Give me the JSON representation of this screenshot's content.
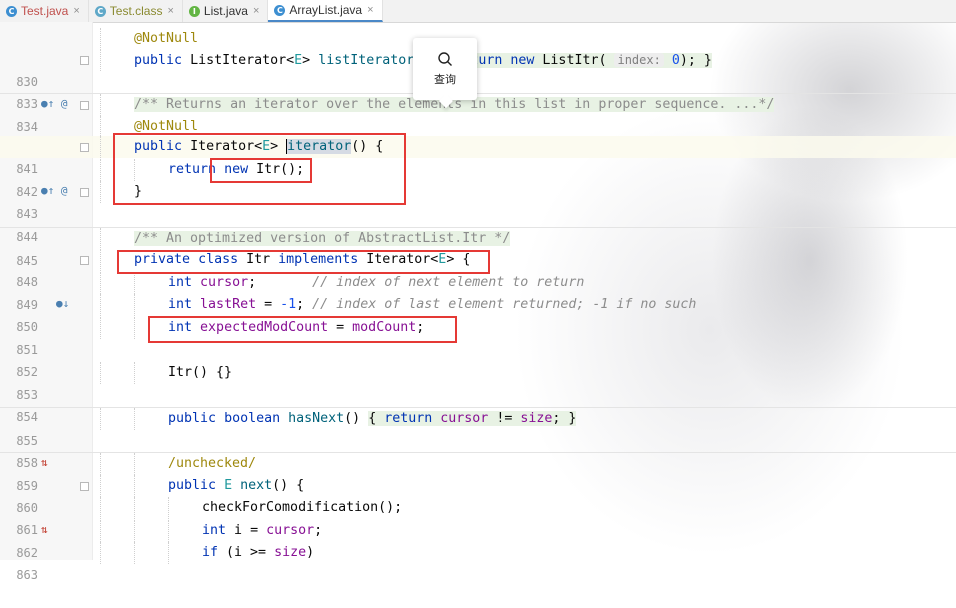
{
  "tabs": [
    {
      "name": "Test.java",
      "icon": "class-icon",
      "style": "red"
    },
    {
      "name": "Test.class",
      "icon": "class-file-icon",
      "style": "olive"
    },
    {
      "name": "List.java",
      "icon": "interface-icon",
      "style": "plain"
    },
    {
      "name": "ArrayList.java",
      "icon": "class-icon",
      "style": "active"
    }
  ],
  "tab_close": "×",
  "popup": {
    "label": "查询",
    "icon": "search-icon"
  },
  "lines": {
    "l0": {
      "num": "",
      "text": "@NotNull"
    },
    "l830": {
      "num": "830",
      "mark": "●↑ @"
    },
    "l833": {
      "num": "833"
    },
    "l834": {
      "num": "834",
      "text": "/** Returns an iterator over the elements in this list in proper sequence. ...*/"
    },
    "l834b": {
      "text": "@NotNull"
    },
    "l841": {
      "num": "841",
      "mark": "●↑ @"
    },
    "l842": {
      "num": "842"
    },
    "l843": {
      "num": "843"
    },
    "l844": {
      "num": "844"
    },
    "l845": {
      "num": "845",
      "text": "/** An optimized version of AbstractList.Itr */"
    },
    "l848": {
      "num": "848",
      "mark": "●↓"
    },
    "l849": {
      "num": "849",
      "comment": "// index of next element to return"
    },
    "l850": {
      "num": "850",
      "comment": "// index of last element returned; -1 if no such"
    },
    "l851": {
      "num": "851"
    },
    "l852": {
      "num": "852"
    },
    "l853": {
      "num": "853"
    },
    "l854": {
      "num": "854"
    },
    "l855": {
      "num": "855",
      "mark": "⇅"
    },
    "l858": {
      "num": "858"
    },
    "l859": {
      "num": "859",
      "text": "/unchecked/"
    },
    "l860": {
      "num": "860",
      "mark": "⇅"
    },
    "l861": {
      "num": "861"
    },
    "l862": {
      "num": "862"
    },
    "l863": {
      "num": "863"
    }
  },
  "tokens": {
    "public": "public",
    "private": "private",
    "class": "class",
    "implements": "implements",
    "return": "return",
    "new": "new",
    "int": "int",
    "boolean": "boolean",
    "if": "if",
    "ListIterator": "ListIterator",
    "E": "E",
    "listIterator": "listIterator",
    "ListItr": "ListItr",
    "index_hint": "index:",
    "zero": "0",
    "Iterator": "Iterator",
    "iterator": "iterator",
    "Itr": "Itr",
    "cursor": "cursor",
    "lastRet": "lastRet",
    "neg1": "-1",
    "expectedModCount": "expectedModCount",
    "modCount": "modCount",
    "hasNext": "hasNext",
    "size": "size",
    "next": "next",
    "checkForComodification": "checkForComodification",
    "i": "i"
  }
}
